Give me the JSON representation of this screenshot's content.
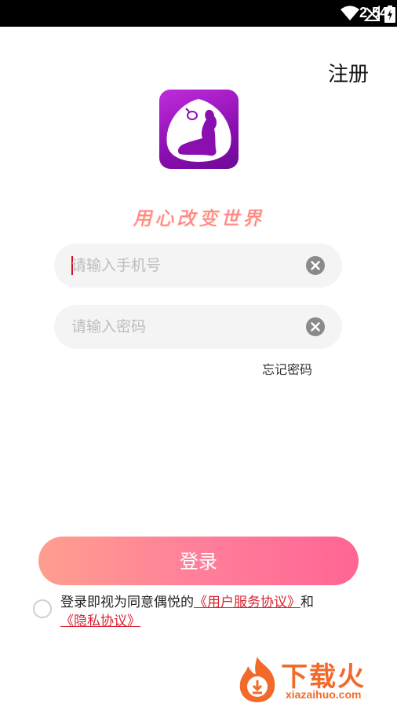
{
  "status_bar": {
    "time": "2:54",
    "icons": [
      "wifi-icon",
      "no-signal-icon",
      "battery-charging-icon"
    ]
  },
  "header": {
    "register_label": "注册"
  },
  "branding": {
    "logo_icon": "silhouette-logo-icon",
    "slogan": "用心改变世界"
  },
  "form": {
    "phone_placeholder": "请输入手机号",
    "password_placeholder": "请输入密码",
    "forgot_label": "忘记密码"
  },
  "login": {
    "label": "登录"
  },
  "agreement": {
    "checked": false,
    "prefix": "登录即视为同意偶悦的",
    "terms_link": "《用户服务协议》",
    "joiner": "和",
    "privacy_link": "《隐私协议》"
  },
  "watermark": {
    "title": "下载火",
    "domain": "xiazaihuo.com"
  },
  "colors": {
    "accent_gradient_start": "#ff9e8e",
    "accent_gradient_end": "#ff6593",
    "link_red": "#d9212f",
    "logo_purple": "#9b15c2"
  }
}
